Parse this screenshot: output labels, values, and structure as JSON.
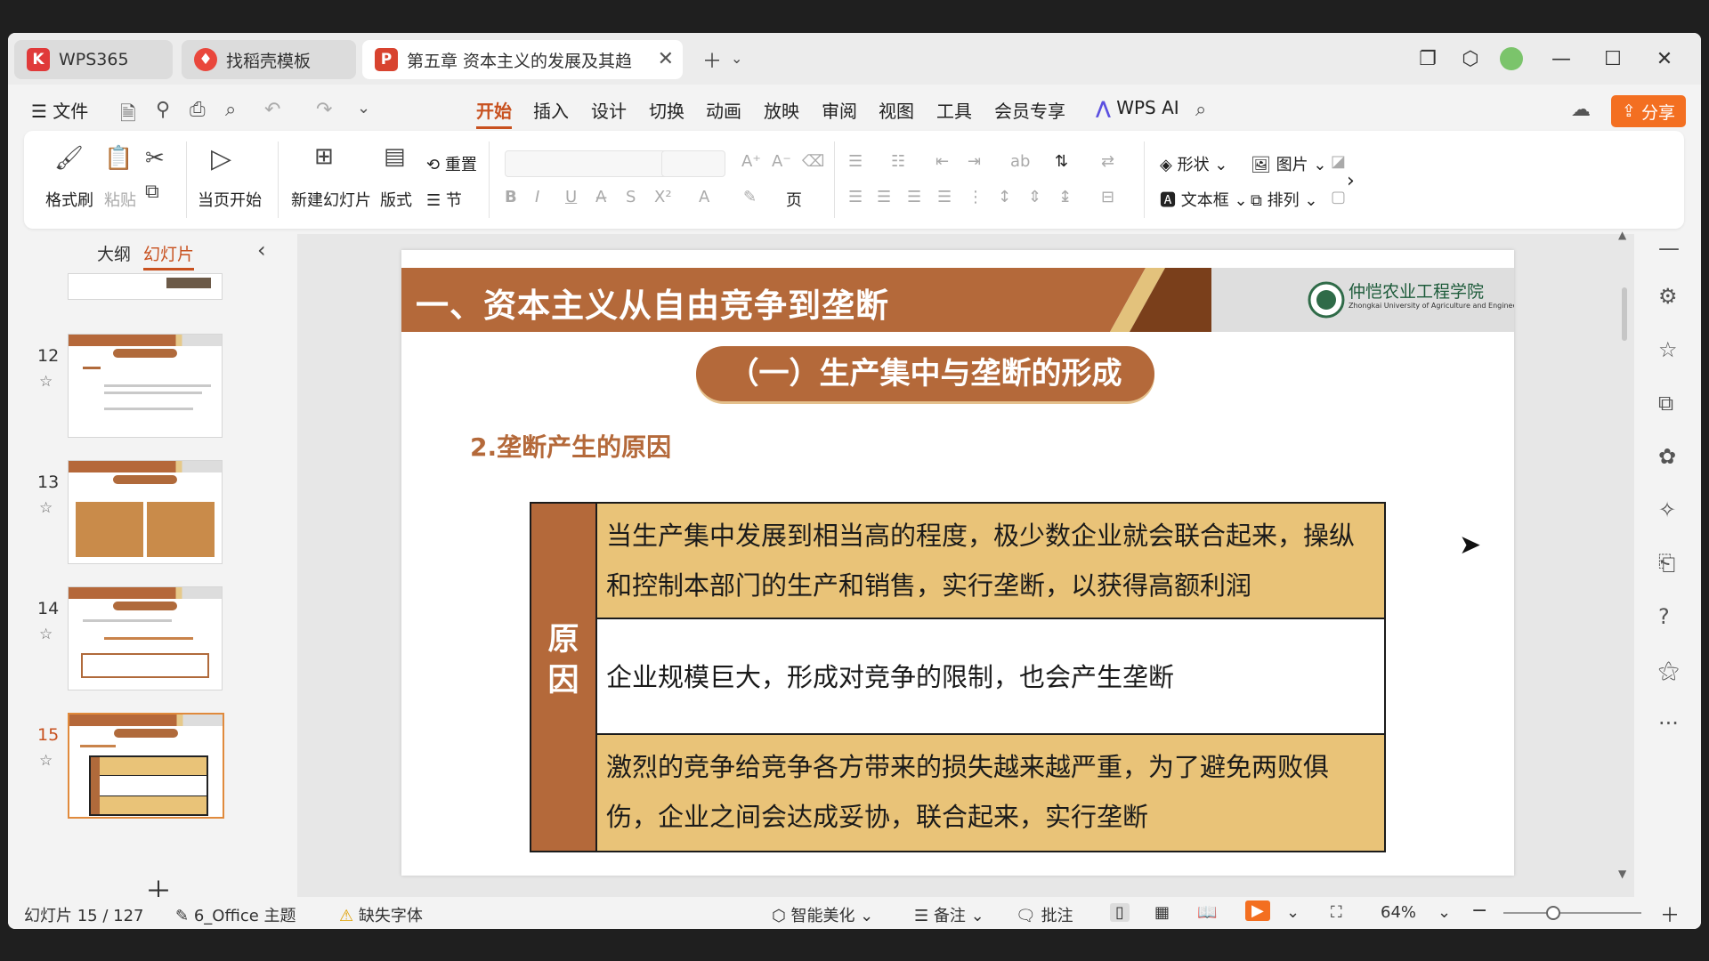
{
  "tabs": [
    {
      "label": "WPS365"
    },
    {
      "label": "找稻壳模板"
    },
    {
      "label": "第五章 资本主义的发展及其趋"
    }
  ],
  "menu": {
    "file": "文件",
    "items": [
      "开始",
      "插入",
      "设计",
      "切换",
      "动画",
      "放映",
      "审阅",
      "视图",
      "工具",
      "会员专享"
    ],
    "ai": "WPS AI",
    "share": "分享"
  },
  "ribbon": {
    "format_painter": "格式刷",
    "paste": "粘贴",
    "start_from_current": "当页开始",
    "new_slide": "新建幻灯片",
    "layout": "版式",
    "reset": "重置",
    "section": "节",
    "shape": "形状",
    "picture": "图片",
    "textbox": "文本框",
    "arrange": "排列"
  },
  "panel": {
    "outline_tab": "大纲",
    "slides_tab": "幻灯片",
    "slide_numbers": [
      "12",
      "13",
      "14",
      "15"
    ]
  },
  "slide": {
    "header_title": "一、资本主义从自由竞争到垄断",
    "logo_text": "仲恺农业工程学院",
    "logo_subtext": "Zhongkai University of Agriculture and Engineering",
    "subtitle": "（一）生产集中与垄断的形成",
    "section_label": "2.垄断产生的原因",
    "table": {
      "header": "原因",
      "rows": [
        "当生产集中发展到相当高的程度，极少数企业就会联合起来，操纵和控制本部门的生产和销售，实行垄断，以获得高额利润",
        "企业规模巨大，形成对竞争的限制，也会产生垄断",
        "激烈的竞争给竞争各方带来的损失越来越严重，为了避免两败俱伤，企业之间会达成妥协，联合起来，实行垄断"
      ]
    }
  },
  "status": {
    "slide_counter": "幻灯片 15 / 127",
    "theme": "6_Office 主题",
    "missing_font": "缺失字体",
    "smart_beautify": "智能美化",
    "notes": "备注",
    "comments": "批注",
    "zoom": "64%"
  },
  "colors": {
    "accent": "#b4693a",
    "highlight_row": "#e9c378",
    "share_button": "#f36f21"
  }
}
